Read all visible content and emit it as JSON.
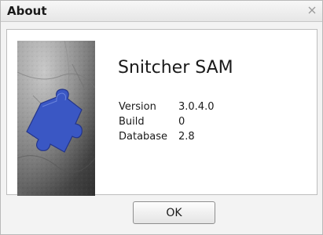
{
  "window": {
    "title": "About",
    "close_icon": "close-icon"
  },
  "about": {
    "app_name": "Snitcher SAM",
    "graphic_icon": "puzzle-piece-icon",
    "rows": [
      {
        "label": "Version",
        "value": "3.0.4.0"
      },
      {
        "label": "Build",
        "value": "0"
      },
      {
        "label": "Database",
        "value": "2.8"
      }
    ]
  },
  "buttons": {
    "ok_label": "OK"
  },
  "colors": {
    "puzzle_blue": "#3a57c4"
  }
}
